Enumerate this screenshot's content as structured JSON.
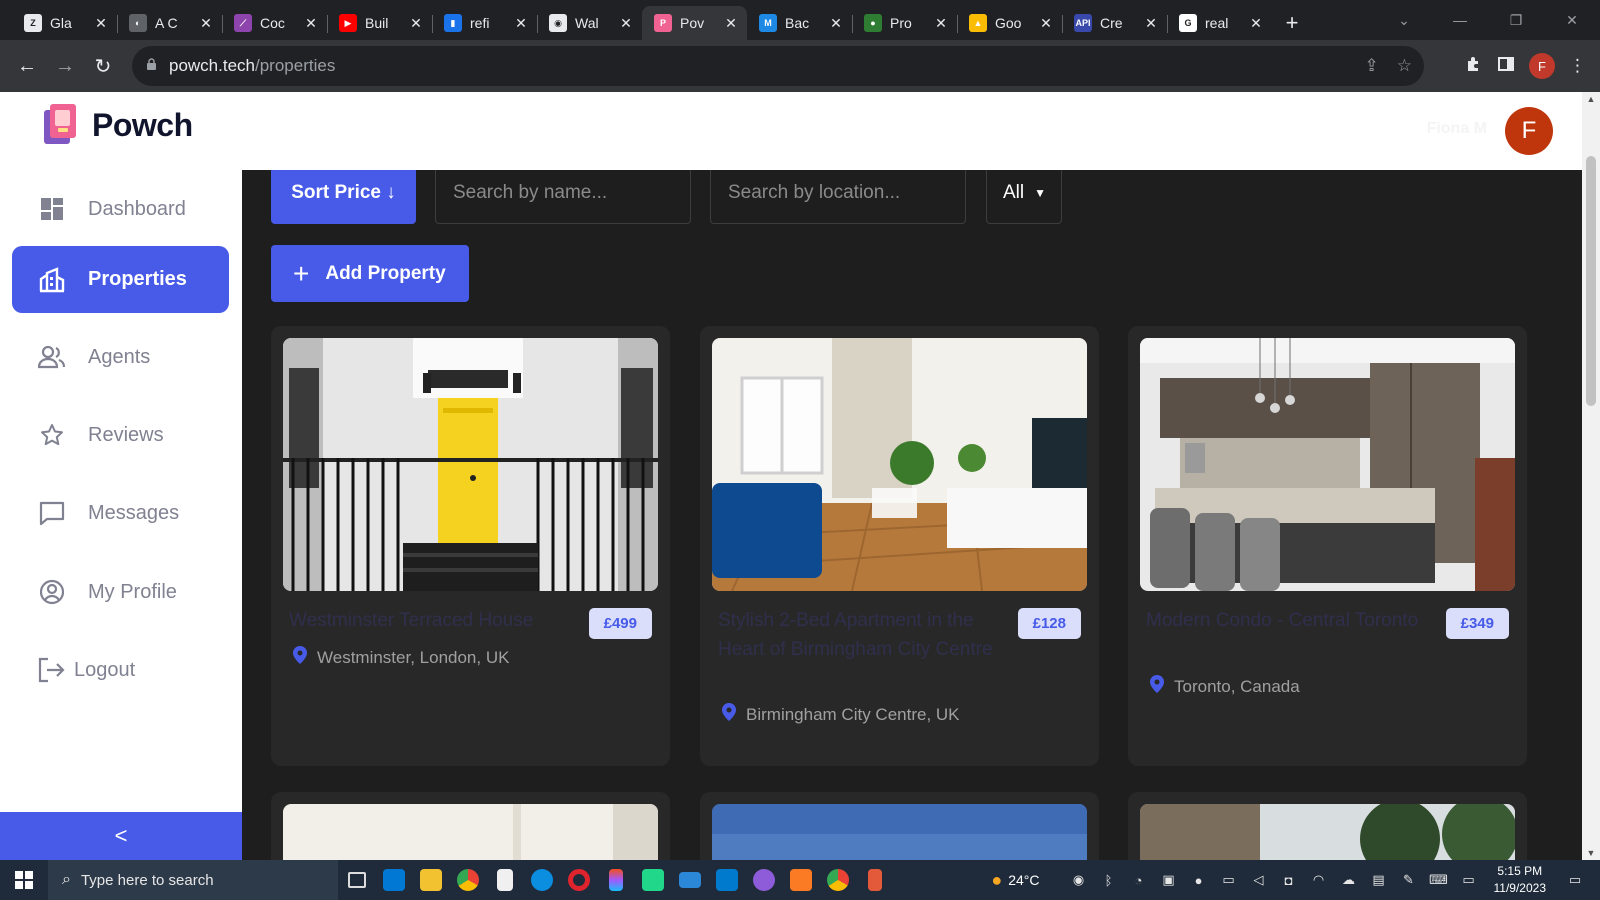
{
  "browser": {
    "tabs": [
      {
        "title": "Gla",
        "fav_color": "#e8eaed",
        "fav_text": "Z"
      },
      {
        "title": "A C",
        "fav_color": "#5f6368",
        "fav_text": "◐"
      },
      {
        "title": "Coc",
        "fav_color": "#8e44ad",
        "fav_text": "⟋"
      },
      {
        "title": "Buil",
        "fav_color": "#ff0000",
        "fav_text": "▶"
      },
      {
        "title": "refi",
        "fav_color": "#1a73e8",
        "fav_text": "▮"
      },
      {
        "title": "Wal",
        "fav_color": "#e8eaed",
        "fav_text": "◉"
      },
      {
        "title": "Pov",
        "fav_color": "#f06292",
        "fav_text": "P",
        "active": true
      },
      {
        "title": "Bac",
        "fav_color": "#1e88e5",
        "fav_text": "M"
      },
      {
        "title": "Pro",
        "fav_color": "#2e7d32",
        "fav_text": "●"
      },
      {
        "title": "Goo",
        "fav_color": "#fbbc04",
        "fav_text": "▲"
      },
      {
        "title": "Cre",
        "fav_color": "#3949ab",
        "fav_text": "API"
      },
      {
        "title": "real",
        "fav_color": "#ffffff",
        "fav_text": "G"
      }
    ],
    "url_host": "powch.tech",
    "url_path": "/properties",
    "profile_initial": "F"
  },
  "app": {
    "logo_text": "Powch",
    "user_name": "Fiona M",
    "user_initial": "F",
    "nav": [
      {
        "label": "Dashboard",
        "icon": "dashboard-icon"
      },
      {
        "label": "Properties",
        "icon": "properties-icon",
        "active": true
      },
      {
        "label": "Agents",
        "icon": "agents-icon"
      },
      {
        "label": "Reviews",
        "icon": "star-icon"
      },
      {
        "label": "Messages",
        "icon": "message-icon"
      },
      {
        "label": "My Profile",
        "icon": "profile-icon"
      },
      {
        "label": "Logout",
        "icon": "logout-icon"
      }
    ],
    "collapse_symbol": "<"
  },
  "filters": {
    "sort_label": "Sort Price ↓",
    "search_name_placeholder": "Search by name...",
    "search_location_placeholder": "Search by location...",
    "type_selected": "All",
    "add_label": "Add Property"
  },
  "properties": [
    {
      "title": "Westminster Terraced House",
      "price": "£499",
      "location": "Westminster, London, UK",
      "image": "yellow-door-townhouse"
    },
    {
      "title": "Stylish 2-Bed Apartment in the Heart of Birmingham City Centre",
      "price": "£128",
      "location": "Birmingham City Centre, UK",
      "image": "living-room"
    },
    {
      "title": "Modern Condo - Central Toronto",
      "price": "£349",
      "location": "Toronto, Canada",
      "image": "modern-kitchen"
    }
  ],
  "taskbar": {
    "search_placeholder": "Type here to search",
    "temperature": "24°C",
    "time": "5:15 PM",
    "date": "11/9/2023"
  }
}
